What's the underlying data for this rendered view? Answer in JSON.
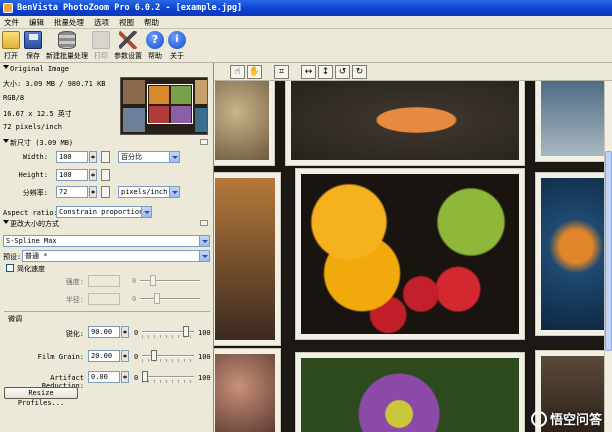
{
  "window": {
    "title": "BenVista PhotoZoom Pro 6.0.2 - [example.jpg]"
  },
  "menu": [
    "文件",
    "编辑",
    "批量处理",
    "选项",
    "视图",
    "帮助"
  ],
  "toolbar": {
    "open": "打开",
    "save": "保存",
    "batch": "新建批量处理",
    "print": "打印",
    "settings": "参数设置",
    "help": "帮助",
    "about": "关于"
  },
  "original": {
    "header": "Original Image",
    "size": "大小: 3.09 MB / 980.71 KB",
    "ratio": "RGB/8",
    "dimensions": "16.67 x 12.5 英寸",
    "resolution": "72 pixels/inch"
  },
  "newsize": {
    "header": "新尺寸 (3.09 MB)",
    "width_label": "Width:",
    "width_value": "100",
    "height_label": "Height:",
    "height_value": "100",
    "res_label": "分辨率:",
    "res_value": "72",
    "unit": "百分比",
    "res_unit": "pixels/inch",
    "aspect_label": "Aspect ratio:",
    "aspect_value": "Constrain proportions"
  },
  "method": {
    "header": "更改大小的方式",
    "algorithm": "S-Spline Max",
    "preset_label": "预设:",
    "preset_value": "普通 *",
    "fast_label": "简化速度",
    "intensity_label": "强度:",
    "intensity_value": "0",
    "radius_label": "半径:",
    "radius_value": "0"
  },
  "fine_tune": {
    "header": "微调",
    "sharpness_label": "锐化:",
    "sharpness_value": "90.00",
    "sharpness_min": "0",
    "sharpness_max": "100",
    "sharpness_level": 0.9,
    "grain_label": "Film Grain:",
    "grain_value": "20.00",
    "grain_min": "0",
    "grain_max": "100",
    "grain_level": 0.2,
    "artifact_label": "Artifact Reduction:",
    "artifact_value": "0.00",
    "artifact_min": "0",
    "artifact_max": "100",
    "artifact_level": 0.0
  },
  "resize_profiles_button": "Resize Profiles...",
  "watermark": "悟空问答",
  "colors": {
    "title_bar": "#0a3fcf",
    "panel": "#ece9d8",
    "canvas": "#1a1714"
  }
}
